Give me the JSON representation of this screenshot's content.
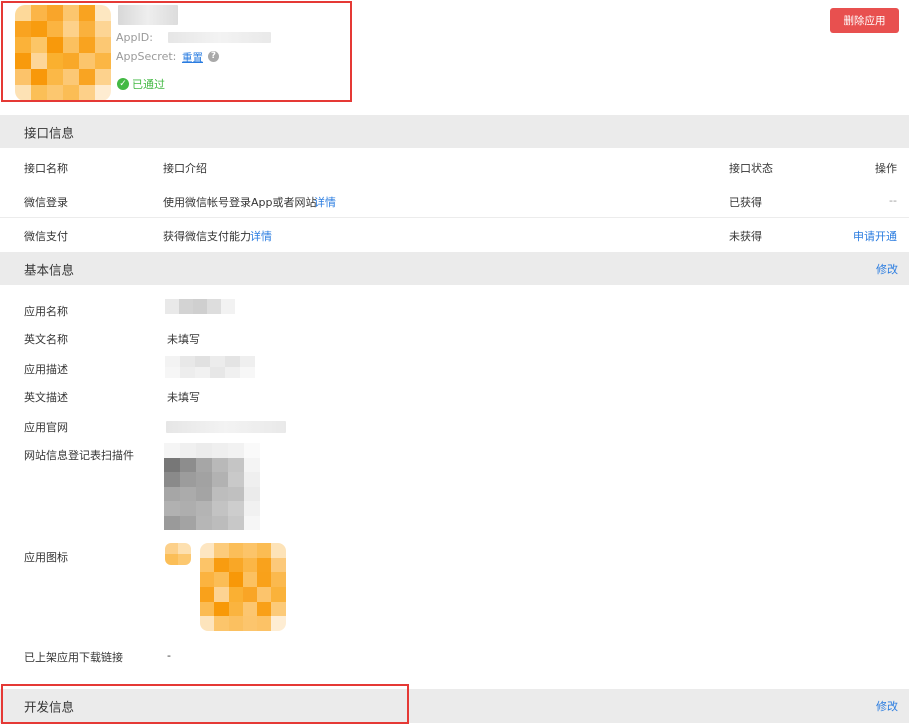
{
  "app": {
    "appid_label": "AppID:",
    "appsecret_label": "AppSecret:",
    "reset_link": "重置",
    "status_text": "已通过",
    "delete_button": "删除应用"
  },
  "interface_section": {
    "title": "接口信息",
    "columns": {
      "name": "接口名称",
      "intro": "接口介绍",
      "status": "接口状态",
      "action": "操作"
    },
    "rows": [
      {
        "name": "微信登录",
        "intro": "使用微信帐号登录App或者网站",
        "detail": "详情",
        "status": "已获得",
        "action": "--"
      },
      {
        "name": "微信支付",
        "intro": "获得微信支付能力",
        "detail": "详情",
        "status": "未获得",
        "action": "申请开通"
      }
    ]
  },
  "basic_section": {
    "title": "基本信息",
    "edit": "修改",
    "fields": {
      "app_name": "应用名称",
      "en_name": "英文名称",
      "en_name_value": "未填写",
      "app_desc": "应用描述",
      "en_desc": "英文描述",
      "en_desc_value": "未填写",
      "website": "应用官网",
      "scan": "网站信息登记表扫描件",
      "icon": "应用图标",
      "download": "已上架应用下载链接",
      "download_value": "-"
    }
  },
  "dev_section": {
    "title": "开发信息",
    "edit": "修改"
  },
  "colors": {
    "link": "#2a7ce0",
    "danger": "#e8504f",
    "success": "#43b944",
    "section_bg": "#ebebeb",
    "highlight_box": "#e53935"
  }
}
